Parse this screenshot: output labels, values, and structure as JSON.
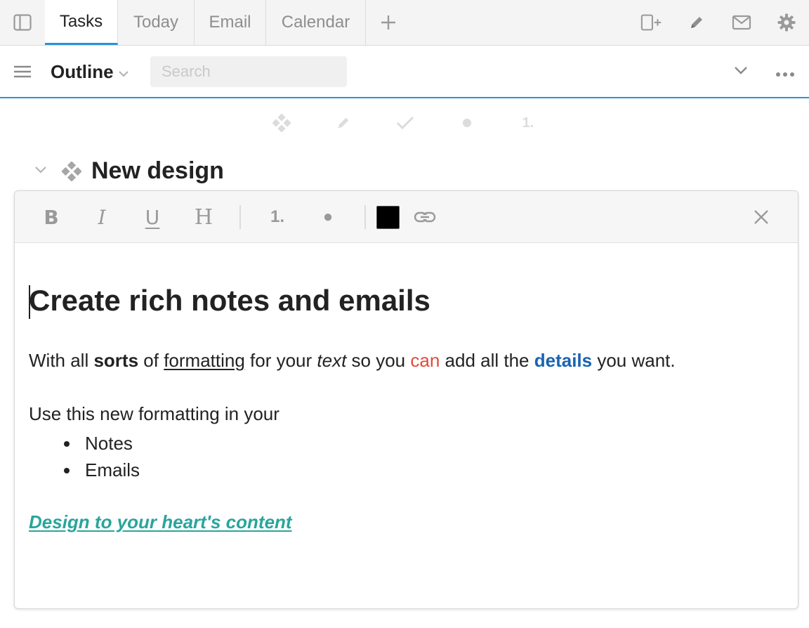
{
  "tabbar": {
    "tabs": [
      {
        "label": "Tasks",
        "active": true
      },
      {
        "label": "Today",
        "active": false
      },
      {
        "label": "Email",
        "active": false
      },
      {
        "label": "Calendar",
        "active": false
      }
    ],
    "add_tab_icon": "plus-icon",
    "right_icons": [
      "add-column-icon",
      "pencil-icon",
      "mail-icon",
      "gear-icon"
    ]
  },
  "header": {
    "title": "Outline",
    "search": {
      "placeholder": "Search",
      "value": ""
    },
    "accent_color": "#2a93d5"
  },
  "item_types": [
    "project-diamond-icon",
    "note-pencil-icon",
    "task-check-icon",
    "bullet-icon",
    "1."
  ],
  "task": {
    "title": "New design"
  },
  "editor": {
    "toolbar": {
      "bold": "B",
      "italic": "I",
      "underline": "U",
      "heading": "H",
      "ordered_list": "1.",
      "bullet": "●",
      "text_color": "#000000",
      "link_icon": "link-icon",
      "close_icon": "close-icon"
    },
    "heading": "Create rich notes and emails",
    "paragraph": {
      "t1": "With all ",
      "t2": "sorts",
      "t3": " of ",
      "t4": "formatting",
      "t5": " for your ",
      "t6": "text",
      "t7": " so you ",
      "t8": "can",
      "t9": " add all the ",
      "t10": "details",
      "t11": " you want."
    },
    "use_line": "Use this new formatting in your",
    "bullets": [
      "Notes",
      "Emails"
    ],
    "link_text": "Design to your heart's content",
    "colors": {
      "red": "#e14b3a",
      "blue": "#1a64b0",
      "teal": "#2aa59b"
    }
  }
}
